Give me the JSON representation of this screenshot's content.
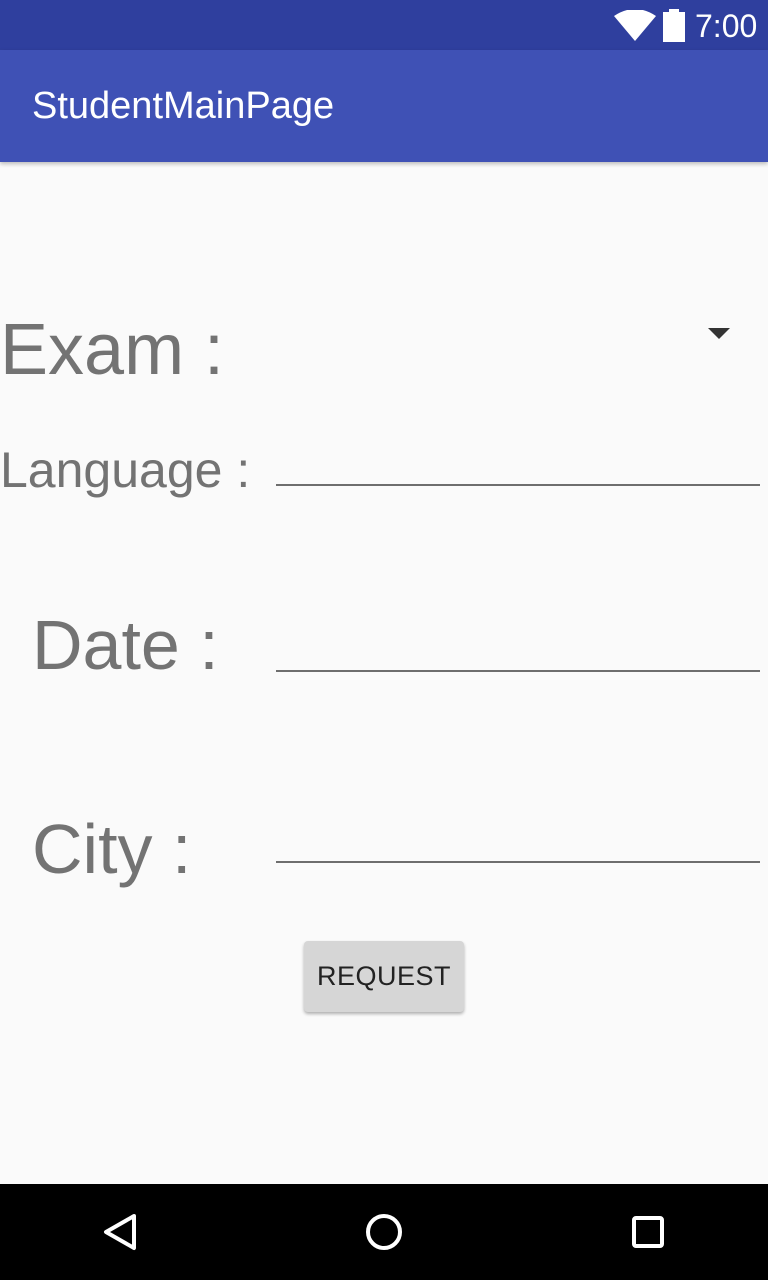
{
  "status_bar": {
    "time": "7:00",
    "icons": [
      "wifi-icon",
      "battery-icon"
    ],
    "background": "#2f3f9e"
  },
  "app_bar": {
    "title": "StudentMainPage",
    "background": "#3f51b5"
  },
  "form": {
    "exam_label": "Exam :",
    "exam_selected": "",
    "language_label": "Language :",
    "language_value": "",
    "date_label": "Date :",
    "date_value": "",
    "city_label": "City :",
    "city_value": "",
    "request_label": "REQUEST"
  },
  "nav_bar": {
    "icons": [
      "back-icon",
      "home-icon",
      "recents-icon"
    ],
    "background": "#000000"
  }
}
